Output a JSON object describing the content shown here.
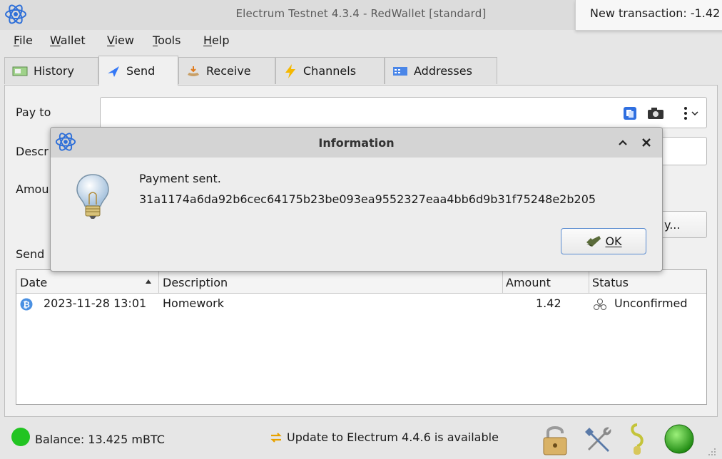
{
  "window": {
    "title": "Electrum Testnet 4.3.4  -  RedWallet  [standard]",
    "notification": "New transaction: -1.42"
  },
  "menu": [
    {
      "label": "File",
      "key": "F",
      "rest": "ile"
    },
    {
      "label": "Wallet",
      "key": "W",
      "rest": "allet"
    },
    {
      "label": "View",
      "key": "V",
      "rest": "iew"
    },
    {
      "label": "Tools",
      "key": "T",
      "rest": "ools"
    },
    {
      "label": "Help",
      "key": "H",
      "rest": "elp"
    }
  ],
  "tabs": [
    {
      "label": "History",
      "icon": "history-icon"
    },
    {
      "label": "Send",
      "icon": "send-icon",
      "active": true
    },
    {
      "label": "Receive",
      "icon": "receive-icon"
    },
    {
      "label": "Channels",
      "icon": "lightning-icon"
    },
    {
      "label": "Addresses",
      "icon": "addresses-icon"
    }
  ],
  "send_form": {
    "pay_to_label": "Pay to",
    "pay_to_value": "",
    "description_label": "Descr",
    "amount_label": "Amou",
    "send_section_label": "Send",
    "pay_button_partial": "y..."
  },
  "table": {
    "headers": {
      "date": "Date",
      "description": "Description",
      "amount": "Amount",
      "status": "Status"
    },
    "rows": [
      {
        "date": "2023-11-28 13:01",
        "description": "Homework",
        "amount": "1.42",
        "status": "Unconfirmed"
      }
    ]
  },
  "dialog": {
    "title": "Information",
    "line1": "Payment sent.",
    "line2": "31a1174a6da92b6cec64175b23be093ea9552327eaa4bb6d9b31f75248e2b205",
    "ok_label": "OK"
  },
  "status": {
    "balance": "Balance: 13.425 mBTC",
    "update": "Update to Electrum 4.4.6 is available"
  },
  "colors": {
    "accent": "#3478f6",
    "online_green": "#2ecc2e",
    "bitcoin_badge": "#4a90e2"
  }
}
